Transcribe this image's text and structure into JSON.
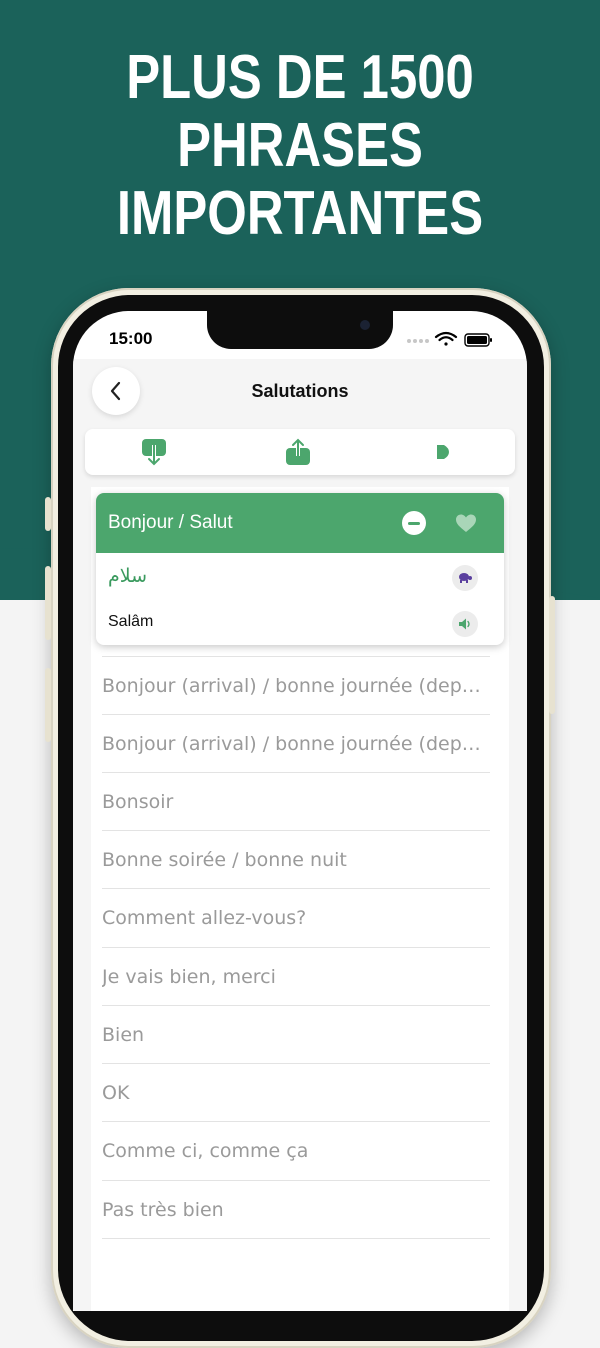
{
  "headline": {
    "line1": "PLUS DE 1500",
    "line2": "PHRASES",
    "line3": "IMPORTANTES"
  },
  "colors": {
    "brand_dark": "#1b625a",
    "accent_green": "#4ca66d",
    "background": "#f4f4f4"
  },
  "status_bar": {
    "time": "15:00"
  },
  "nav": {
    "title": "Salutations",
    "back_icon": "chevron-left-icon"
  },
  "toolbar": {
    "icons": [
      "download-icon",
      "share-icon",
      "play-icon"
    ]
  },
  "selected_phrase": {
    "french": "Bonjour / Salut",
    "arabic": "سلام",
    "transliteration": "Salâm",
    "icons": [
      "remove-icon",
      "favorite-heart-icon",
      "slow-speed-turtle-icon",
      "speaker-icon"
    ]
  },
  "phrases": [
    "Bonjour (arrival) / bonne journée (dep…",
    "Bonjour (arrival) / bonne journée (dep…",
    "Bonsoir",
    "Bonne soirée / bonne nuit",
    "Comment allez-vous?",
    "Je vais bien, merci",
    "Bien",
    "OK",
    "Comme ci, comme ça",
    "Pas très bien"
  ]
}
